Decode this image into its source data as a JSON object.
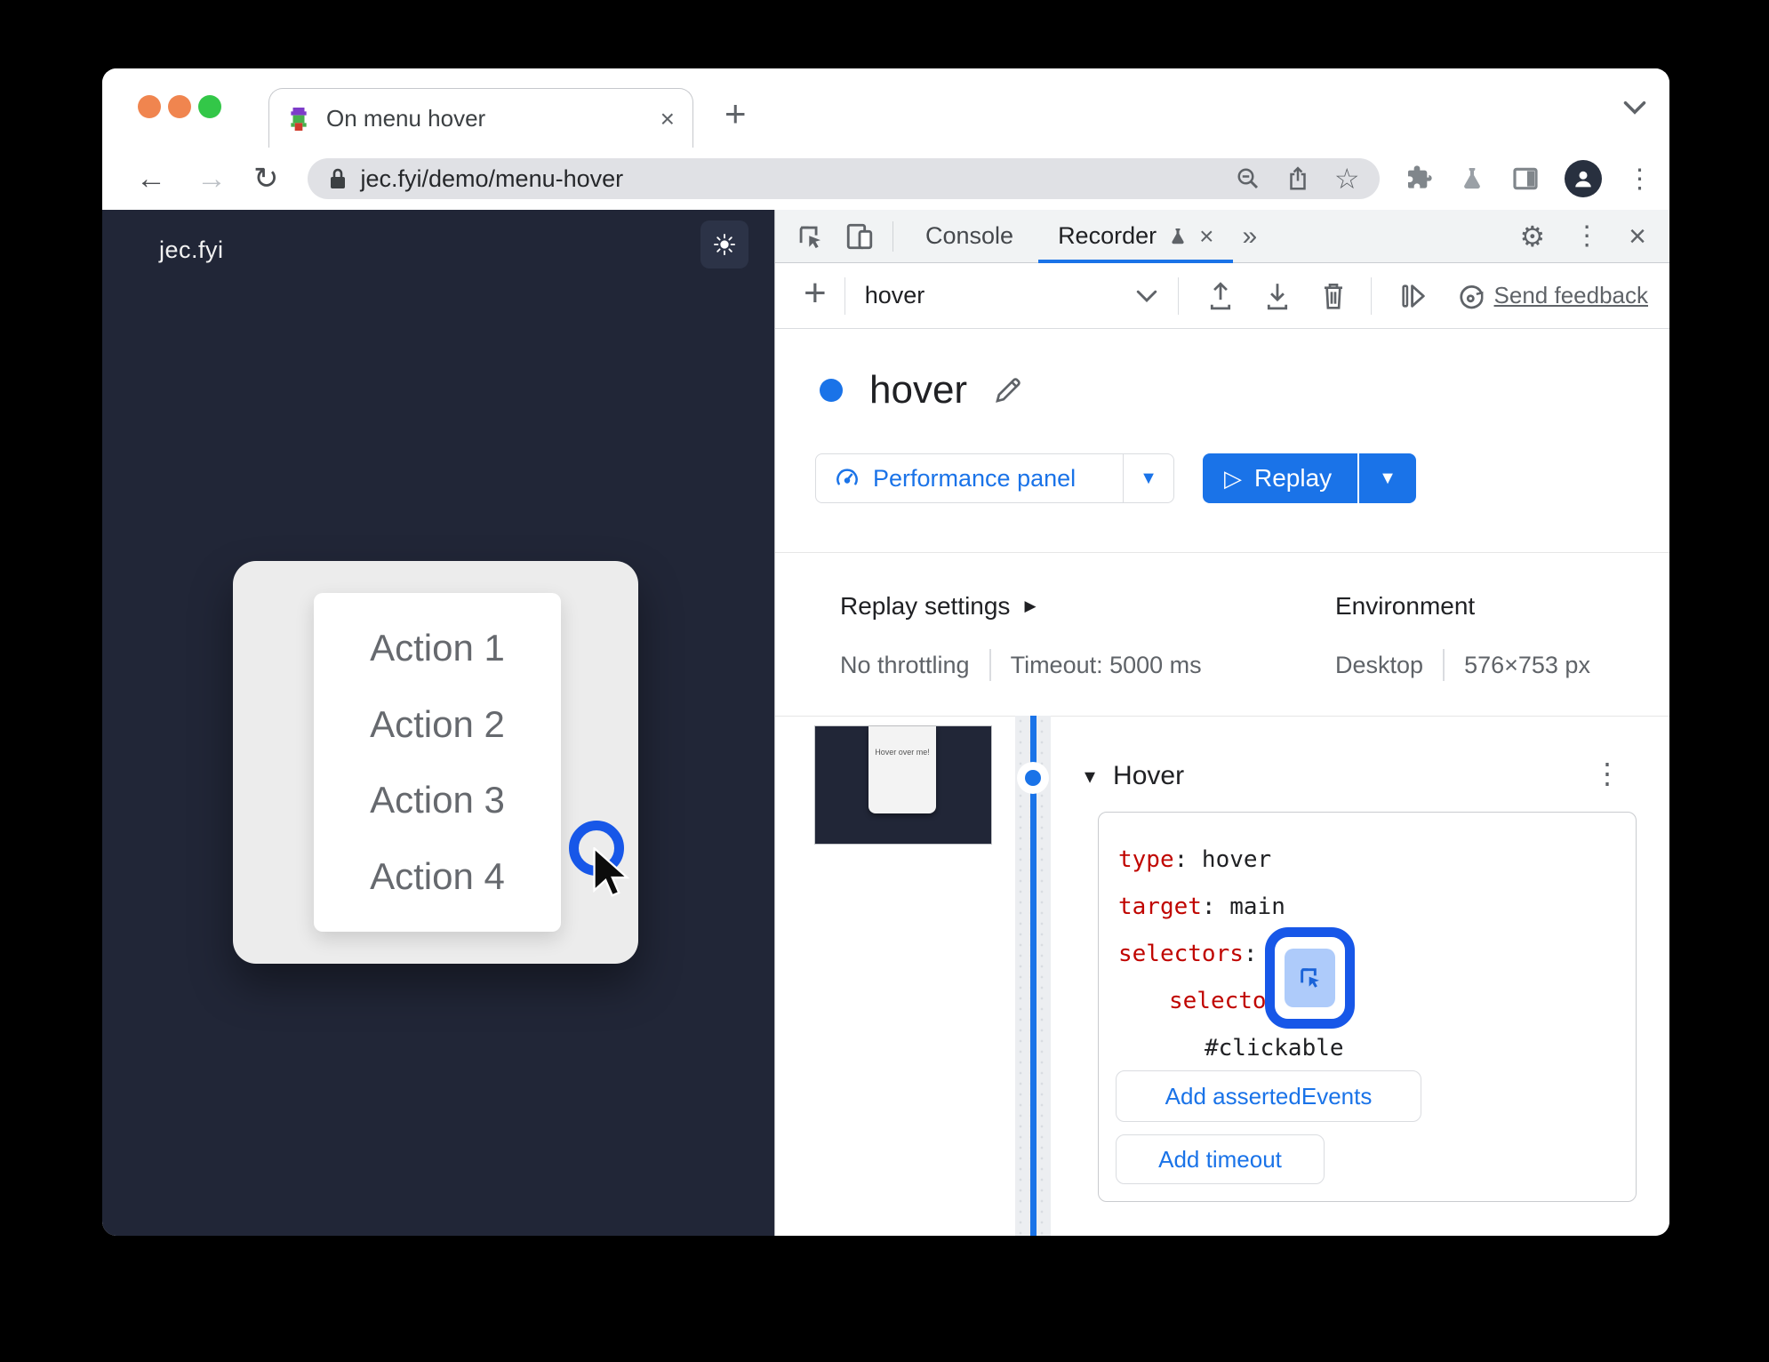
{
  "colors": {
    "accent_blue": "#1a73e8",
    "highlight_ring_blue": "#1757e8",
    "code_key_red": "#c00500",
    "page_dark_bg": "#212637",
    "traffic_lights": [
      "#f0854f",
      "#f0854f",
      "#33c748"
    ]
  },
  "tab": {
    "title": "On menu hover"
  },
  "omnibox": {
    "url": "jec.fyi/demo/menu-hover"
  },
  "page": {
    "brand": "jec.fyi",
    "hover_text": "Hover over me!",
    "menu_items": [
      "Action 1",
      "Action 2",
      "Action 3",
      "Action 4"
    ]
  },
  "devtools": {
    "tabs": {
      "console": "Console",
      "recorder": "Recorder"
    },
    "toolbar": {
      "recording_name": "hover",
      "send_feedback": "Send feedback"
    },
    "recording": {
      "title": "hover"
    },
    "actions": {
      "performance": "Performance panel",
      "replay": "Replay"
    },
    "replay_settings": {
      "heading": "Replay settings",
      "throttling": "No throttling",
      "timeout": "Timeout: 5000 ms"
    },
    "environment": {
      "heading": "Environment",
      "device": "Desktop",
      "viewport": "576×753 px"
    },
    "step": {
      "title": "Hover",
      "thumb_text": "Hover over me!",
      "code": {
        "colon": ":",
        "l1k": "type",
        "l1v": " hover",
        "l2k": "target",
        "l2v": " main",
        "l3k": "selectors",
        "l4k": "selector #1",
        "l5v": "#clickable"
      },
      "buttons": {
        "add_asserted": "Add assertedEvents",
        "add_timeout": "Add timeout"
      }
    }
  },
  "icons": {
    "back": "←",
    "forward": "→",
    "reload": "↻",
    "star": "☆",
    "more_tabs": "»",
    "kebab": "⋮",
    "close": "×",
    "plus": "+",
    "gear": "⚙",
    "caret_down": "▼",
    "small_caret": "▾",
    "tri_right": "▶",
    "play": "▷"
  }
}
